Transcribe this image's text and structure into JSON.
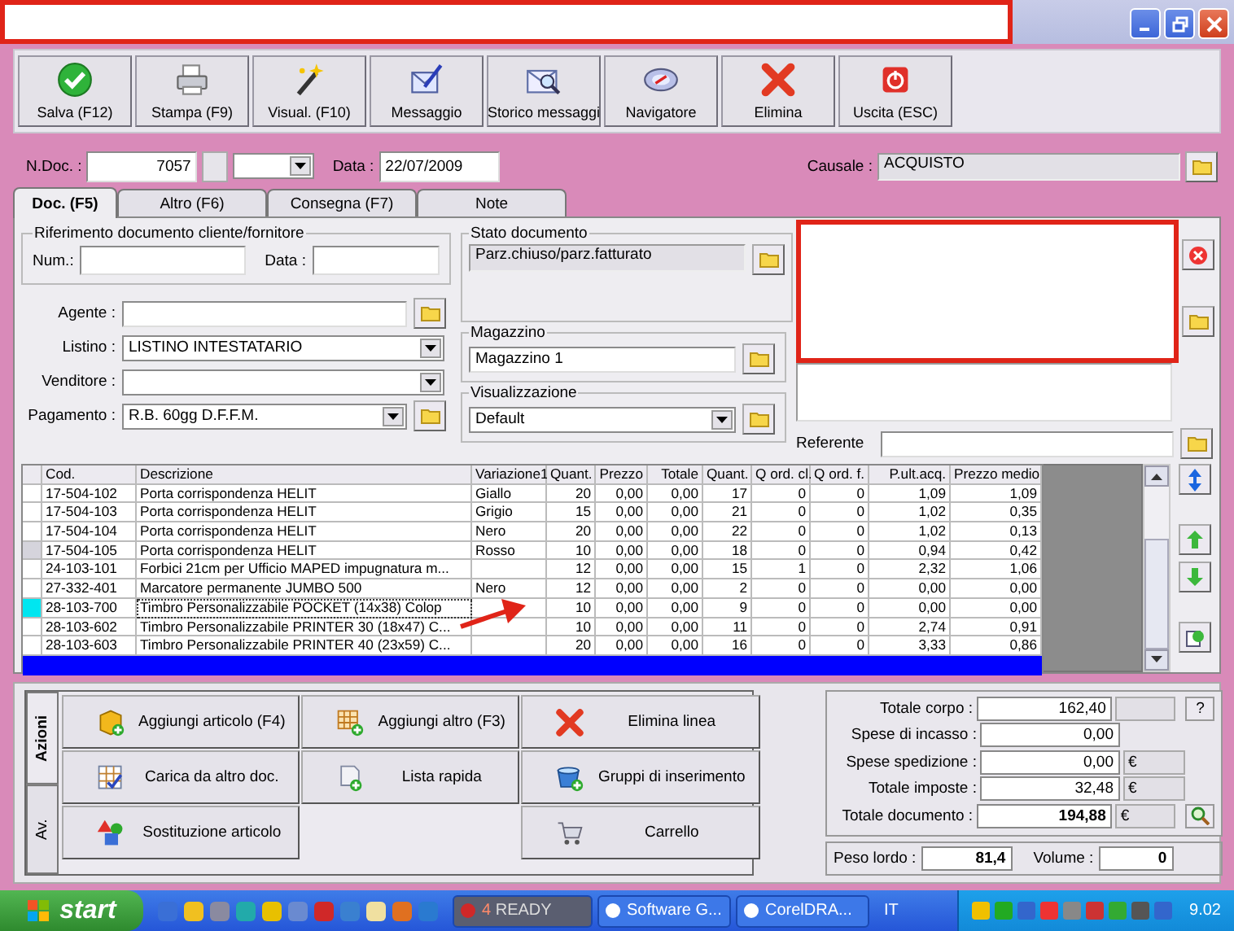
{
  "toolbar": [
    {
      "label": "Salva (F12)",
      "kind": "check"
    },
    {
      "label": "Stampa (F9)",
      "kind": "printer"
    },
    {
      "label": "Visual. (F10)",
      "kind": "wand"
    },
    {
      "label": "Messaggio",
      "kind": "pen"
    },
    {
      "label": "Storico messaggi",
      "kind": "envelope"
    },
    {
      "label": "Navigatore",
      "kind": "compass"
    },
    {
      "label": "Elimina",
      "kind": "cross"
    },
    {
      "label": "Uscita (ESC)",
      "kind": "power"
    }
  ],
  "header": {
    "ndoc_label": "N.Doc. :",
    "ndoc_value": "7057",
    "data_label": "Data :",
    "data_value": "22/07/2009",
    "causale_label": "Causale :",
    "causale_value": "ACQUISTO"
  },
  "tabs": [
    {
      "label": "Doc. (F5)",
      "selected": true
    },
    {
      "label": "Altro (F6)",
      "selected": false
    },
    {
      "label": "Consegna (F7)",
      "selected": false
    },
    {
      "label": "Note",
      "selected": false
    }
  ],
  "riferimento": {
    "title": "Riferimento documento cliente/fornitore",
    "num_label": "Num.:",
    "data_label": "Data :"
  },
  "fields": [
    {
      "label": "Agente :",
      "kind": "lookup"
    },
    {
      "label": "Listino :",
      "value": "LISTINO INTESTATARIO",
      "kind": "dropdown"
    },
    {
      "label": "Venditore :",
      "kind": "dropdown"
    },
    {
      "label": "Pagamento :",
      "value": "R.B. 60gg D.F.F.M.",
      "kind": "dropdown_lookup"
    }
  ],
  "stato": {
    "title": "Stato documento",
    "value": "Parz.chiuso/parz.fatturato"
  },
  "magazzino": {
    "title": "Magazzino",
    "value": "Magazzino 1"
  },
  "visualizzazione": {
    "title": "Visualizzazione",
    "value": "Default"
  },
  "referente": {
    "label": "Referente"
  },
  "table": {
    "columns": [
      "Cod.",
      "Descrizione",
      "Variazione1",
      "Quant.",
      "Prezzo",
      "Totale",
      "Quant.",
      "Q ord. cl.",
      "Q ord. f.",
      "P.ult.acq.",
      "Prezzo medio"
    ],
    "rows": [
      {
        "cells": [
          "17-504-102",
          "Porta corrispondenza HELIT",
          "Giallo",
          "20",
          "0,00",
          "0,00",
          "17",
          "0",
          "0",
          "1,09",
          "1,09"
        ],
        "selected": false,
        "marked": false
      },
      {
        "cells": [
          "17-504-103",
          "Porta corrispondenza HELIT",
          "Grigio",
          "15",
          "0,00",
          "0,00",
          "21",
          "0",
          "0",
          "1,02",
          "0,35"
        ],
        "selected": false,
        "marked": false
      },
      {
        "cells": [
          "17-504-104",
          "Porta corrispondenza HELIT",
          "Nero",
          "20",
          "0,00",
          "0,00",
          "22",
          "0",
          "0",
          "1,02",
          "0,13"
        ],
        "selected": false,
        "marked": false
      },
      {
        "cells": [
          "17-504-105",
          "Porta corrispondenza HELIT",
          "Rosso",
          "10",
          "0,00",
          "0,00",
          "18",
          "0",
          "0",
          "0,94",
          "0,42"
        ],
        "selected": false,
        "marked": true
      },
      {
        "cells": [
          "24-103-101",
          "Forbici 21cm per Ufficio MAPED impugnatura m...",
          "",
          "12",
          "0,00",
          "0,00",
          "15",
          "1",
          "0",
          "2,32",
          "1,06"
        ],
        "selected": false,
        "marked": false
      },
      {
        "cells": [
          "27-332-401",
          "Marcatore permanente JUMBO 500",
          "Nero",
          "12",
          "0,00",
          "0,00",
          "2",
          "0",
          "0",
          "0,00",
          "0,00"
        ],
        "selected": false,
        "marked": false
      },
      {
        "cells": [
          "28-103-700",
          "Timbro Personalizzabile POCKET (14x38) Colop",
          "",
          "10",
          "0,00",
          "0,00",
          "9",
          "0",
          "0",
          "0,00",
          "0,00"
        ],
        "selected": true,
        "marked": false
      },
      {
        "cells": [
          "28-103-602",
          "Timbro Personalizzabile PRINTER 30 (18x47) C...",
          "",
          "10",
          "0,00",
          "0,00",
          "11",
          "0",
          "0",
          "2,74",
          "0,91"
        ],
        "selected": false,
        "marked": false
      },
      {
        "cells": [
          "28-103-603",
          "Timbro Personalizzabile PRINTER 40 (23x59) C...",
          "",
          "20",
          "0,00",
          "0,00",
          "16",
          "0",
          "0",
          "3,33",
          "0,86"
        ],
        "selected": false,
        "marked": false
      }
    ]
  },
  "side_tabs": [
    {
      "label": "Azioni",
      "selected": true
    },
    {
      "label": "Av.",
      "selected": false
    }
  ],
  "action_columns": [
    [
      {
        "label": "Aggiungi articolo (F4)",
        "kind": "box_add"
      },
      {
        "label": "Carica da altro doc.",
        "kind": "grid_check"
      },
      {
        "label": "Sostituzione articolo",
        "kind": "shapes"
      }
    ],
    [
      {
        "label": "Aggiungi altro (F3)",
        "kind": "grid_add"
      },
      {
        "label": "Lista rapida",
        "kind": "list_add"
      }
    ],
    [
      {
        "label": "Elimina linea",
        "kind": "cross"
      },
      {
        "label": "Gruppi di inserimento",
        "kind": "group_add"
      },
      {
        "label": "Carrello",
        "kind": "cart"
      }
    ]
  ],
  "totals": [
    {
      "label": "Totale corpo :",
      "value": "162,40",
      "bold": false,
      "kind": "blank",
      "action": {
        "kind": "help",
        "label": "?"
      }
    },
    {
      "label": "Spese di incasso :",
      "value": "0,00",
      "bold": false,
      "kind": "plain"
    },
    {
      "label": "Spese spedizione :",
      "value": "0,00",
      "bold": false,
      "kind": "currency",
      "unit": "€"
    },
    {
      "label": "Totale imposte :",
      "value": "32,48",
      "bold": false,
      "kind": "currency",
      "unit": "€"
    },
    {
      "label": "Totale documento :",
      "value": "194,88",
      "bold": true,
      "kind": "currency",
      "unit": "€",
      "action": {
        "kind": "zoom"
      }
    }
  ],
  "peso": {
    "label": "Peso lordo :",
    "value": "81,4"
  },
  "volume": {
    "label": "Volume :",
    "value": "0"
  },
  "taskbar": {
    "start": "start",
    "tasks": [
      {
        "badge": "4",
        "label": "READY",
        "selected": true
      },
      {
        "label": "Software G...",
        "selected": false
      },
      {
        "label": "CorelDRA...",
        "selected": false
      }
    ],
    "language": "IT",
    "clock": "9.02"
  }
}
